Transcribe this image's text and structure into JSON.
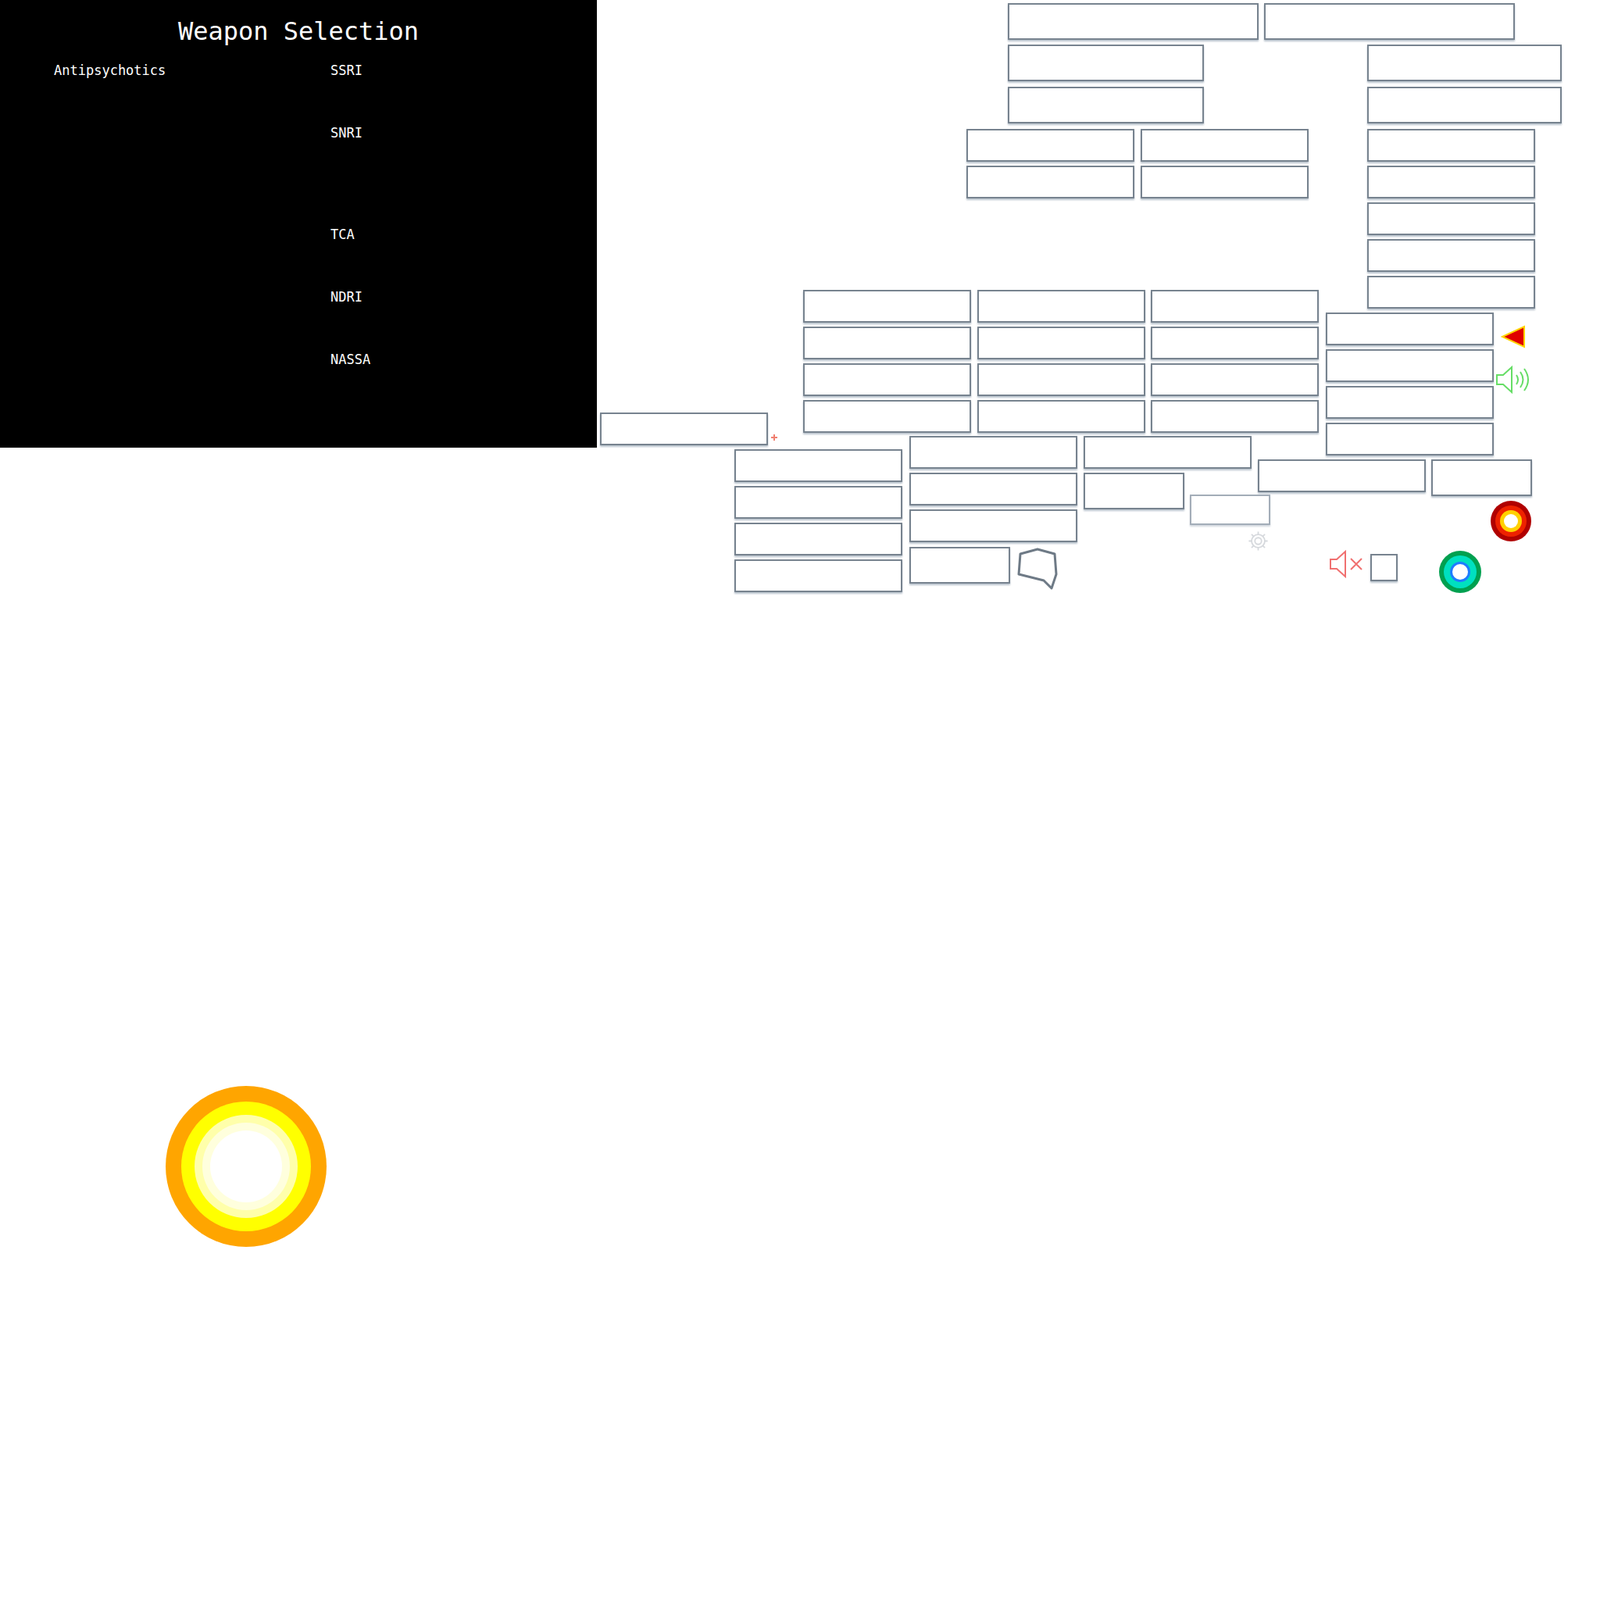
{
  "panel": {
    "title": "Weapon Selection",
    "left_column": [
      "Antipsychotics"
    ],
    "right_column": [
      "SSRI",
      "SNRI",
      "TCA",
      "NDRI",
      "NASSA"
    ]
  }
}
